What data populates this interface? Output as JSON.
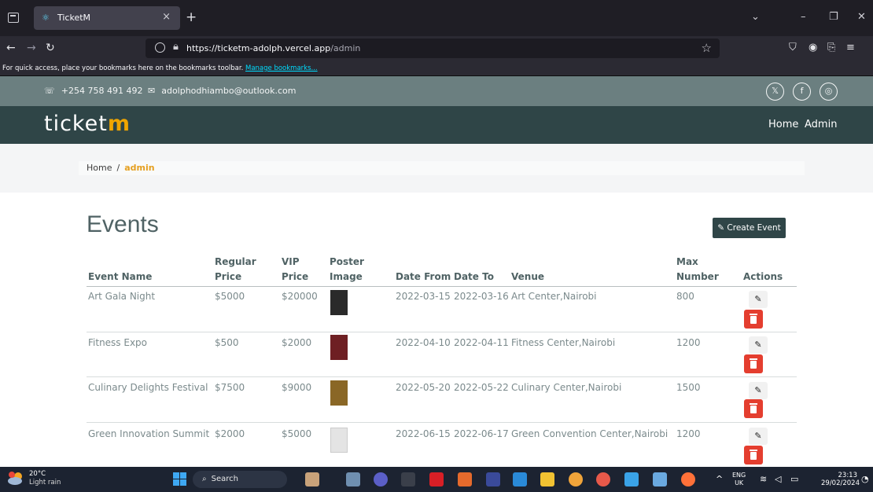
{
  "browser": {
    "tab_title": "TicketM",
    "url_domain": "https://ticketm-adolph.vercel.app",
    "url_path": "/admin",
    "bookmarks_text": "For quick access, place your bookmarks here on the bookmarks toolbar.",
    "bookmarks_link": "Manage bookmarks..."
  },
  "topbar": {
    "phone": "+254 758 491 492",
    "email": "adolphodhiambo@outlook.com",
    "social": [
      "x-icon",
      "facebook-icon",
      "instagram-icon"
    ]
  },
  "nav": {
    "brand_main": "ticket",
    "brand_accent": "m",
    "links": [
      "Home",
      "Admin"
    ]
  },
  "breadcrumb": {
    "home": "Home",
    "separator": "/",
    "current": "admin"
  },
  "page": {
    "title": "Events",
    "create_label": "Create Event"
  },
  "table": {
    "headers": {
      "event_name": "Event Name",
      "regular_price_1": "Regular",
      "regular_price_2": "Price",
      "vip_price_1": "VIP",
      "vip_price_2": "Price",
      "poster_1": "Poster",
      "poster_2": "Image",
      "date_from": "Date From",
      "date_to": "Date To",
      "venue": "Venue",
      "max_number_1": "Max",
      "max_number_2": "Number",
      "actions": "Actions"
    },
    "rows": [
      {
        "name": "Art Gala Night",
        "regular": "$5000",
        "vip": "$20000",
        "date_from": "2022-03-15",
        "date_to": "2022-03-16",
        "venue": "Art Center,Nairobi",
        "max": "800",
        "poster_color": "#3a3a3a"
      },
      {
        "name": "Fitness Expo",
        "regular": "$500",
        "vip": "$2000",
        "date_from": "2022-04-10",
        "date_to": "2022-04-11",
        "venue": "Fitness Center,Nairobi",
        "max": "1200",
        "poster_color": "#7a2a2a"
      },
      {
        "name": "Culinary Delights Festival",
        "regular": "$7500",
        "vip": "$9000",
        "date_from": "2022-05-20",
        "date_to": "2022-05-22",
        "venue": "Culinary Center,Nairobi",
        "max": "1500",
        "poster_color": "#8a6a2a"
      },
      {
        "name": "Green Innovation Summit",
        "regular": "$2000",
        "vip": "$5000",
        "date_from": "2022-06-15",
        "date_to": "2022-06-17",
        "venue": "Green Convention Center,Nairobi",
        "max": "1200",
        "poster_color": "#e8e8e8"
      }
    ]
  },
  "taskbar": {
    "weather_temp": "20°C",
    "weather_desc": "Light rain",
    "search_label": "Search",
    "lang_1": "ENG",
    "lang_2": "UK",
    "time": "23:13",
    "date": "29/02/2024"
  },
  "colors": {
    "topbar": "#6b7f80",
    "navbar": "#2f4547",
    "accent": "#f0a500",
    "delete": "#e43e2f"
  }
}
